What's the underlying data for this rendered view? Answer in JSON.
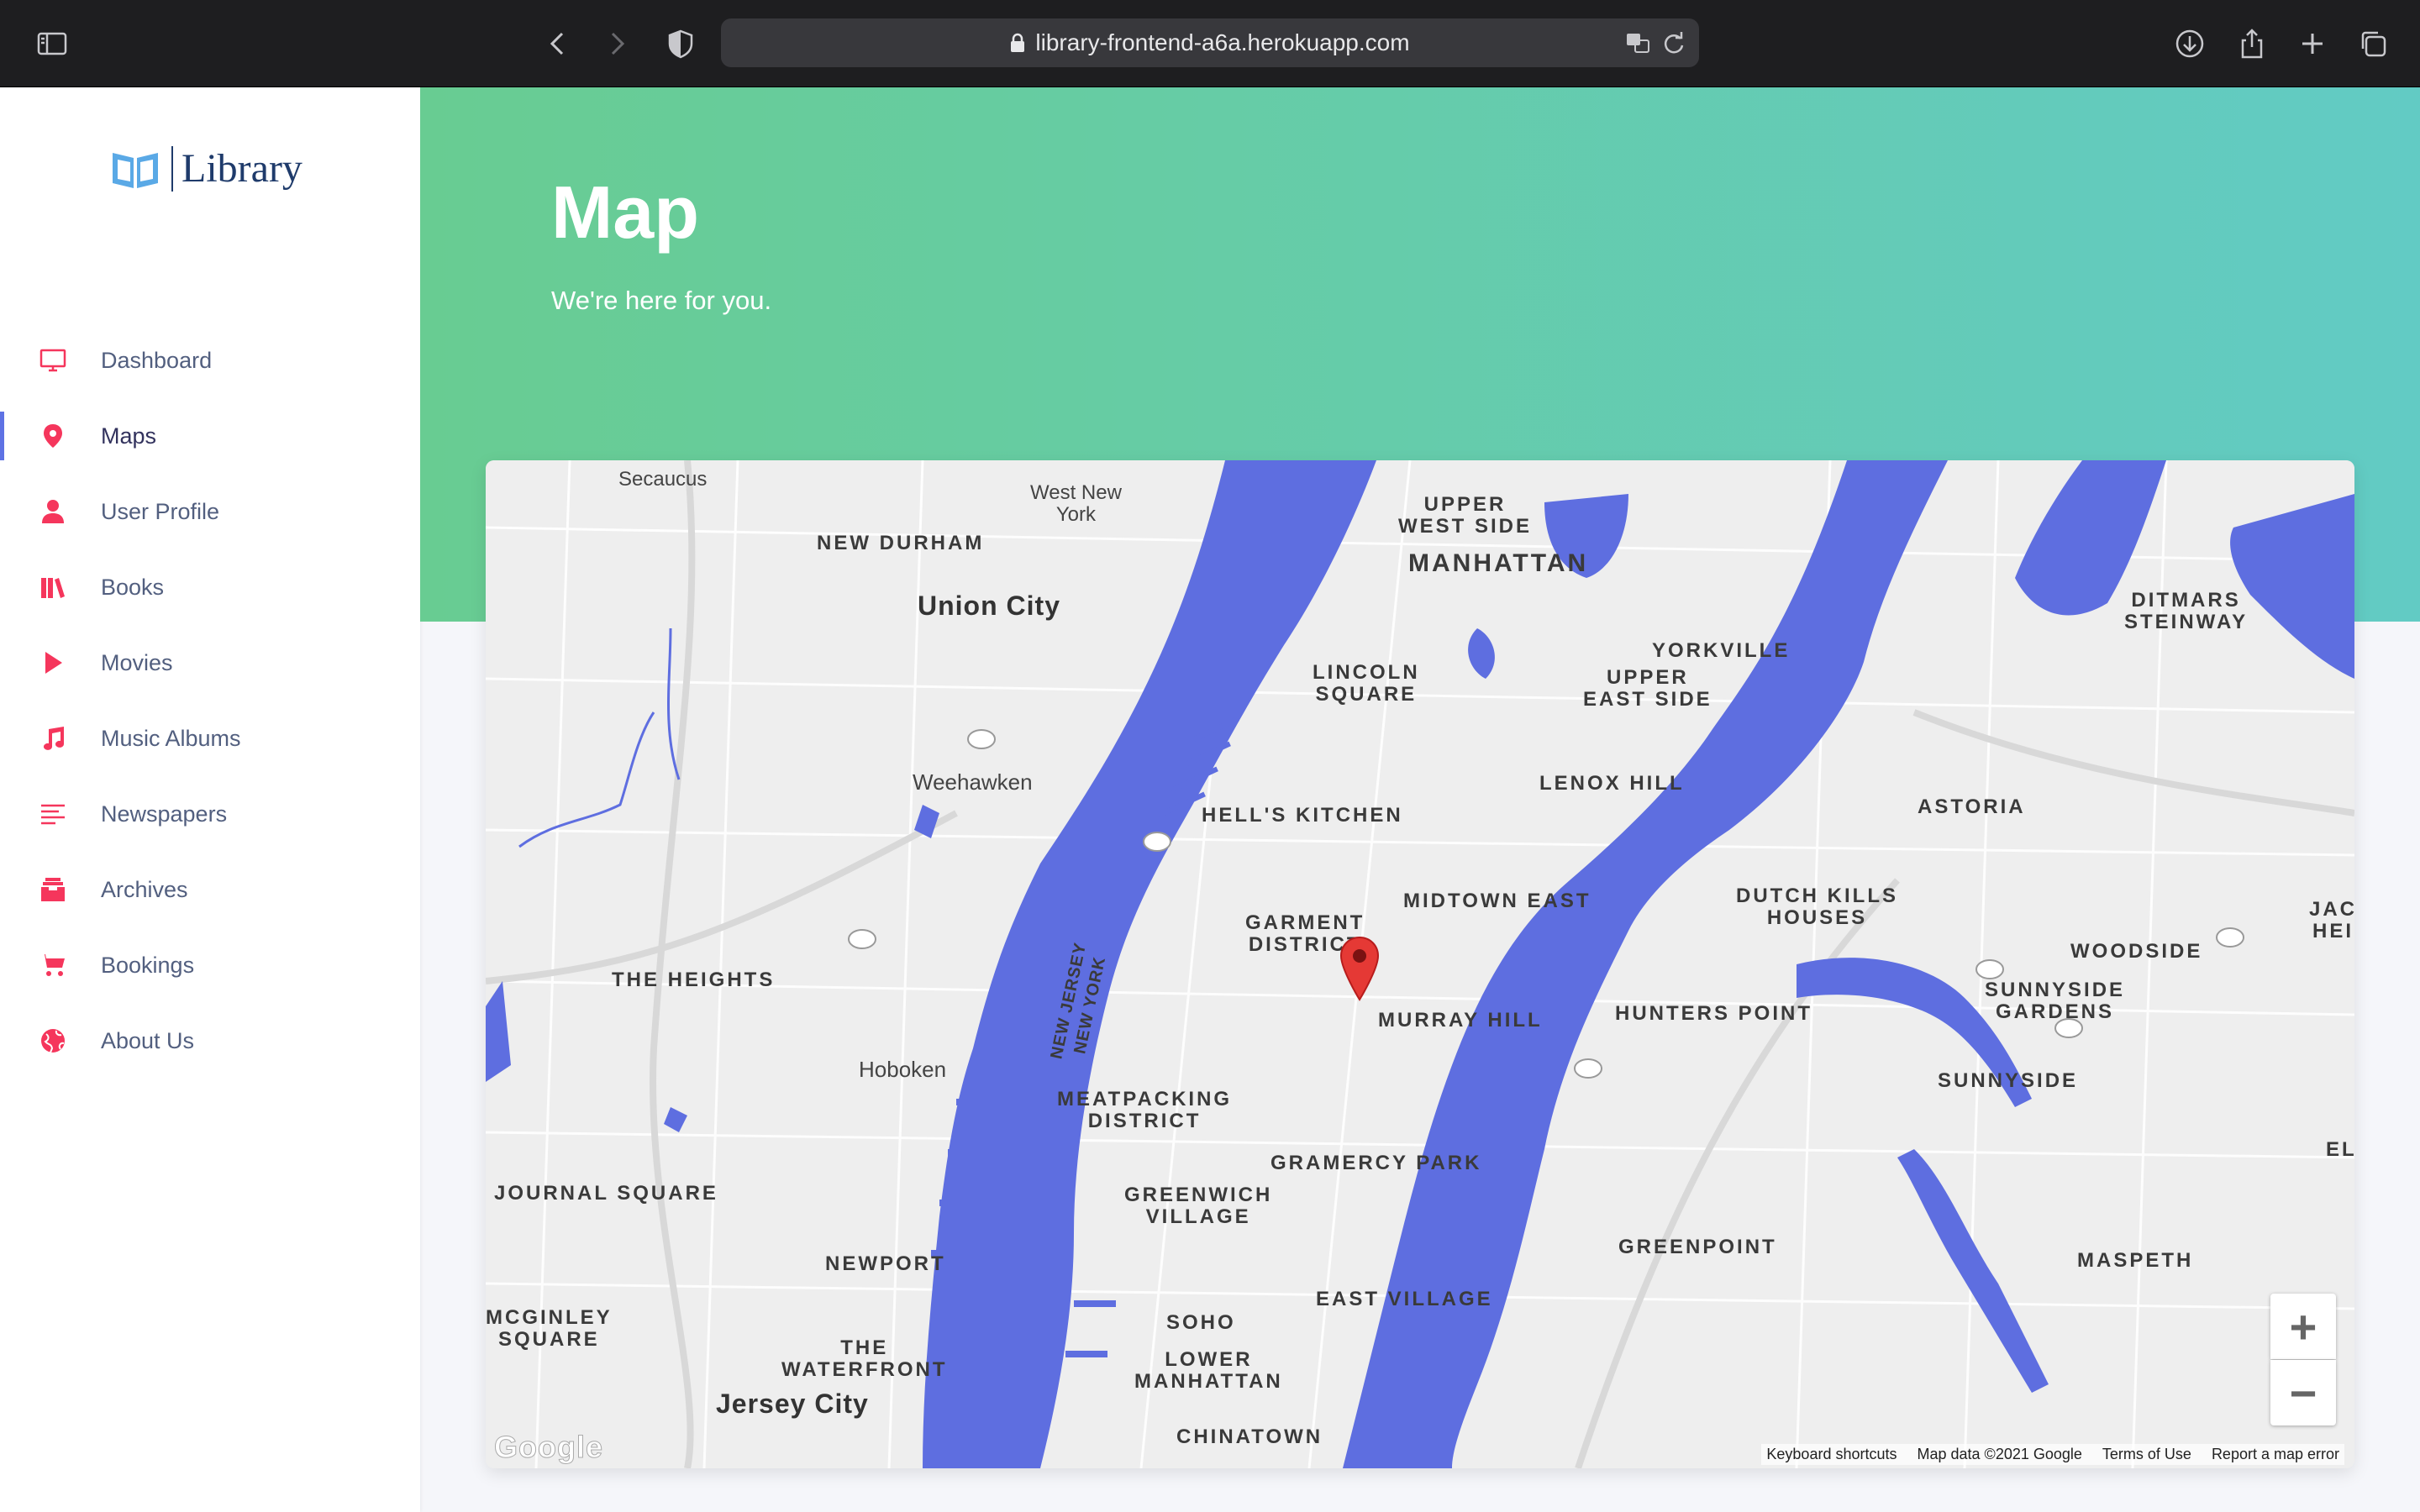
{
  "browser": {
    "url": "library-frontend-a6a.herokuapp.com"
  },
  "sidebar": {
    "logo_text": "Library",
    "items": [
      {
        "label": "Dashboard",
        "icon": "tv-icon",
        "color": "#f5365c"
      },
      {
        "label": "Maps",
        "icon": "map-pin-icon",
        "color": "#f5365c"
      },
      {
        "label": "User Profile",
        "icon": "user-icon",
        "color": "#f5365c"
      },
      {
        "label": "Books",
        "icon": "books-icon",
        "color": "#f5365c"
      },
      {
        "label": "Movies",
        "icon": "play-icon",
        "color": "#f5365c"
      },
      {
        "label": "Music Albums",
        "icon": "music-note-icon",
        "color": "#f5365c"
      },
      {
        "label": "Newspapers",
        "icon": "lines-icon",
        "color": "#f5365c"
      },
      {
        "label": "Archives",
        "icon": "archive-icon",
        "color": "#f5365c"
      },
      {
        "label": "Bookings",
        "icon": "cart-icon",
        "color": "#f5365c"
      },
      {
        "label": "About Us",
        "icon": "globe-icon",
        "color": "#f5365c"
      }
    ],
    "active": "Maps"
  },
  "header": {
    "title": "Map",
    "subtitle": "We're here for you."
  },
  "map": {
    "labels": {
      "secaucus": "Secaucus",
      "west_new_york": "West New\nYork",
      "new_durham": "NEW DURHAM",
      "union_city": "Union City",
      "upper_west_side": "UPPER\nWEST SIDE",
      "manhattan": "MANHATTAN",
      "yorkville": "YORKVILLE",
      "upper_east_side": "UPPER\nEAST SIDE",
      "lincoln_square": "LINCOLN\nSQUARE",
      "ditmars": "DITMARS\nSTEINWAY",
      "weehawken": "Weehawken",
      "hells_kitchen": "HELL'S KITCHEN",
      "lenox_hill": "LENOX HILL",
      "astoria": "ASTORIA",
      "garment": "GARMENT\nDISTRICT",
      "midtown_east": "MIDTOWN EAST",
      "dutch_kills": "DUTCH KILLS\nHOUSES",
      "the_heights": "THE HEIGHTS",
      "murray_hill": "MURRAY HILL",
      "hunters_point": "HUNTERS POINT",
      "woodside": "WOODSIDE",
      "sunnyside_gardens": "SUNNYSIDE\nGARDENS",
      "hoboken": "Hoboken",
      "meatpacking": "MEATPACKING\nDISTRICT",
      "sunnyside": "SUNNYSIDE",
      "journal_square": "JOURNAL SQUARE",
      "gramercy": "GRAMERCY PARK",
      "greenwich": "GREENWICH\nVILLAGE",
      "greenpoint": "GREENPOINT",
      "maspeth": "MASPETH",
      "newport": "NEWPORT",
      "east_village": "EAST VILLAGE",
      "mcginley": "MCGINLEY\nSQUARE",
      "soho": "SOHO",
      "waterfront": "THE\nWATERFRONT",
      "lower_manhattan": "LOWER\nMANHATTAN",
      "jersey_city": "Jersey City",
      "chinatown": "CHINATOWN",
      "nj_ny": "NEW JERSEY\nNEW YORK",
      "jac_hei": "JAC\nHEI",
      "el": "EL"
    },
    "zoom_in": "+",
    "zoom_out": "−",
    "footer": {
      "shortcuts": "Keyboard shortcuts",
      "data": "Map data ©2021 Google",
      "terms": "Terms of Use",
      "report": "Report a map error"
    },
    "brand": "Google",
    "water_color": "#5e6ee0",
    "pin_color": "#e53935"
  }
}
